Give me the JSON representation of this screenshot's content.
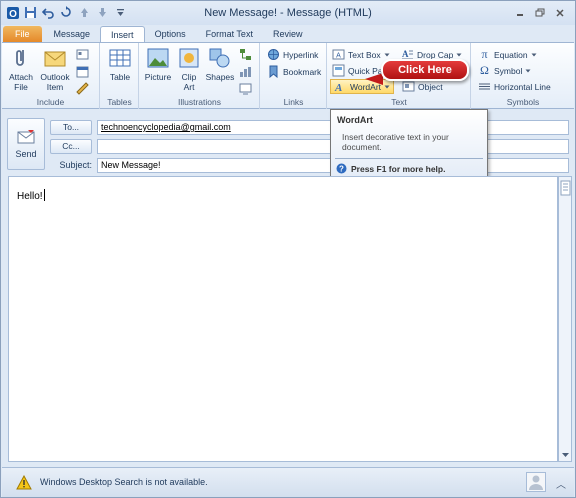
{
  "window": {
    "title": "New Message! - Message (HTML)"
  },
  "tabs": [
    "File",
    "Message",
    "Insert",
    "Options",
    "Format Text",
    "Review"
  ],
  "ribbon": {
    "include": {
      "label": "Include",
      "attach_file": "Attach File",
      "outlook_item": "Outlook Item"
    },
    "tables": {
      "label": "Tables",
      "table": "Table"
    },
    "illustrations": {
      "label": "Illustrations",
      "picture": "Picture",
      "clip_art": "Clip Art",
      "shapes": "Shapes"
    },
    "links": {
      "label": "Links",
      "hyperlink": "Hyperlink",
      "bookmark": "Bookmark"
    },
    "text": {
      "label": "Text",
      "text_box": "Text Box",
      "drop_cap": "Drop Cap",
      "quick_parts": "Quick Pa",
      "wordart": "WordArt",
      "object": "Object"
    },
    "symbols": {
      "label": "Symbols",
      "equation": "Equation",
      "symbol": "Symbol",
      "horizontal_line": "Horizontal Line"
    }
  },
  "callout": {
    "text": "Click Here"
  },
  "tooltip": {
    "title": "WordArt",
    "description": "Insert decorative text in your document.",
    "help": "Press F1 for more help."
  },
  "message": {
    "send_label": "Send",
    "to_label": "To...",
    "cc_label": "Cc...",
    "subject_label": "Subject:",
    "to_value": "technoencyclopedia@gmail.com",
    "cc_value": "",
    "subject_value": "New Message!",
    "body": "Hello!"
  },
  "status": {
    "text": "Windows Desktop Search is not available."
  }
}
